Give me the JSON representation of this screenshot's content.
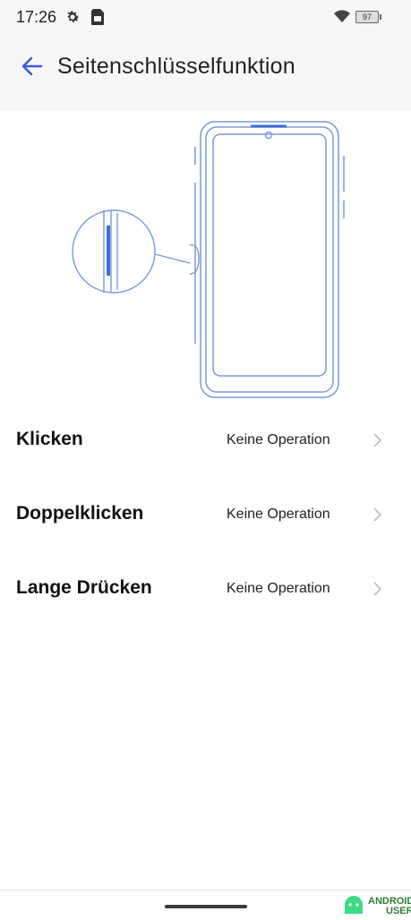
{
  "status_bar": {
    "time": "17:26",
    "battery": "97"
  },
  "header": {
    "title": "Seitenschlüsselfunktion"
  },
  "options": [
    {
      "label": "Klicken",
      "value": "Keine Operation"
    },
    {
      "label": "Doppelklicken",
      "value": "Keine Operation"
    },
    {
      "label": "Lange Drücken",
      "value": "Keine Operation"
    }
  ],
  "watermark": {
    "line1": "ANDROID",
    "line2": "USER"
  },
  "colors": {
    "accent": "#3b5bdb",
    "phone_outline": "#7a9ad6",
    "key_highlight": "#3b6fd8"
  }
}
